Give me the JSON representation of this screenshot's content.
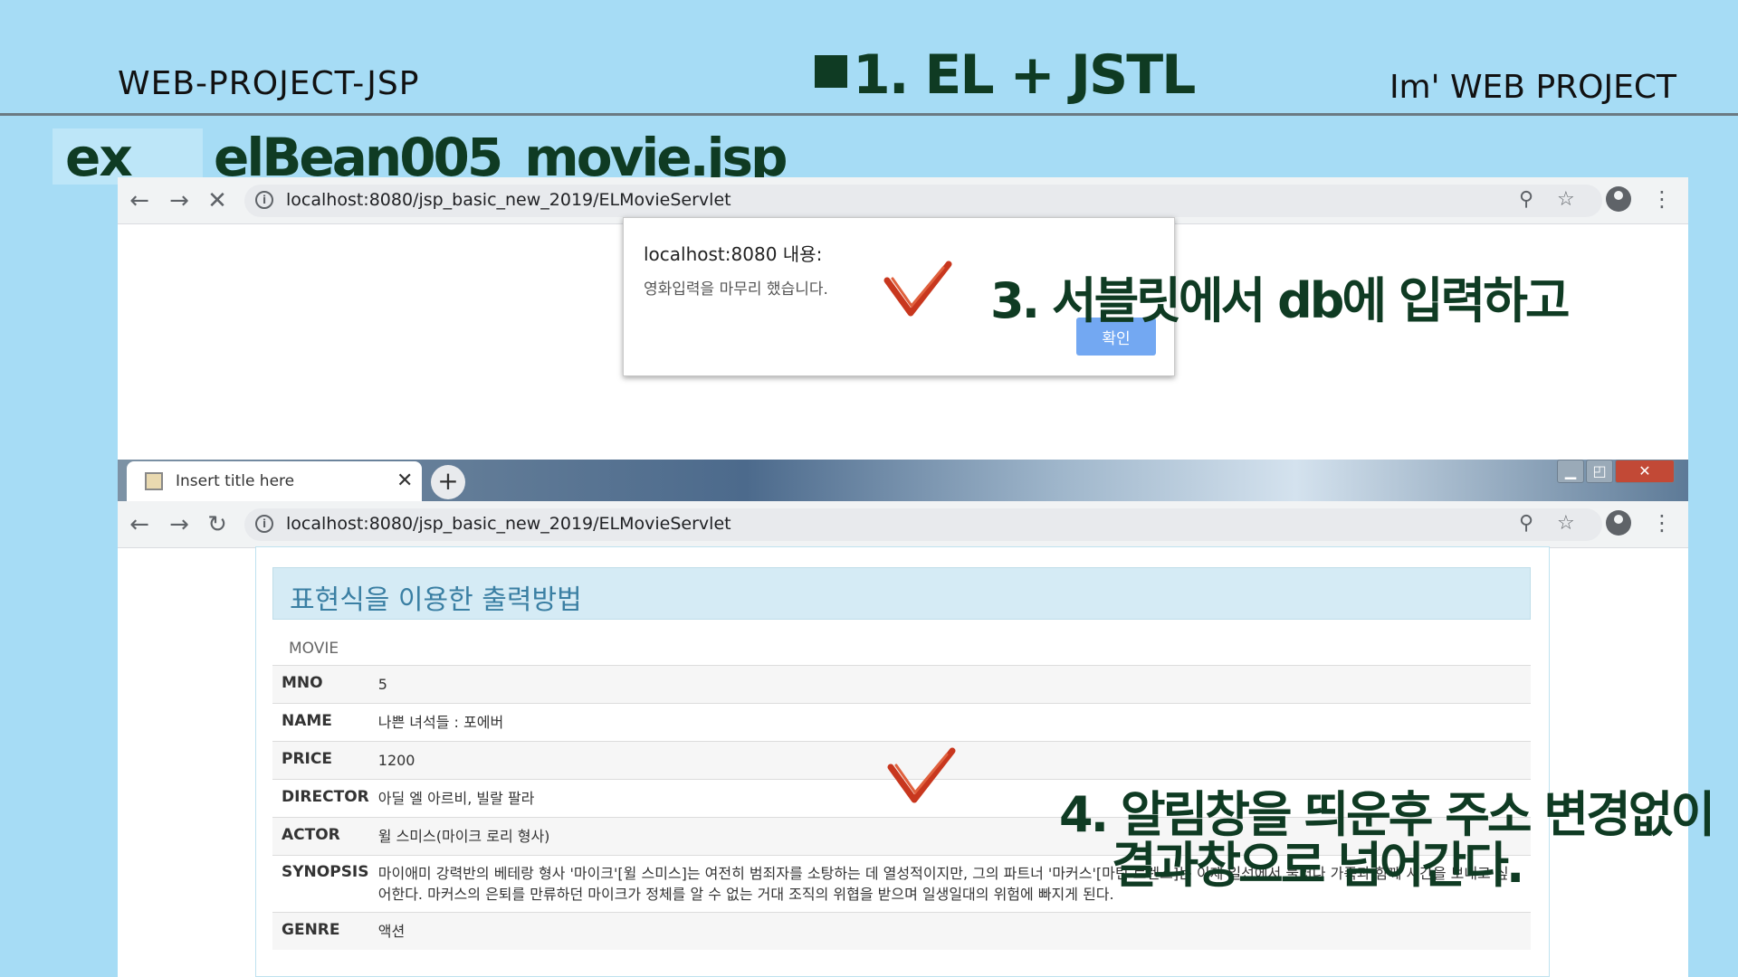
{
  "slide": {
    "left_title": "WEB-PROJECT-JSP",
    "center_title": "1. EL + JSTL",
    "right_title": "Im'  WEB PROJECT",
    "ex_label": "ex",
    "file_title": "elBean005_movie.jsp"
  },
  "browser_top": {
    "url": "localhost:8080/jsp_basic_new_2019/ELMovieServlet"
  },
  "alert": {
    "title": "localhost:8080 내용:",
    "message": "영화입력을 마무리 했습니다.",
    "ok_label": "확인"
  },
  "annotations": {
    "step3": "3. 서블릿에서   db에 입력하고",
    "step4_line1": "4. 알림창을 띄운후 주소 변경없이",
    "step4_line2": "결과창으로 넘어간다."
  },
  "browser_bottom": {
    "tab_title": "Insert title here",
    "url": "localhost:8080/jsp_basic_new_2019/ELMovieServlet"
  },
  "page": {
    "heading": "표현식을 이용한 출력방법",
    "section_label": "MOVIE",
    "rows": [
      {
        "label": "MNO",
        "value": "5"
      },
      {
        "label": "NAME",
        "value": "나쁜 녀석들 : 포에버"
      },
      {
        "label": "PRICE",
        "value": "1200"
      },
      {
        "label": "DIRECTOR",
        "value": "아딜 엘 아르비, 빌랄 팔라"
      },
      {
        "label": "ACTOR",
        "value": "윌 스미스(마이크 로리 형사)"
      },
      {
        "label": "SYNOPSIS",
        "value": "마이애미 강력반의 베테랑 형사 '마이크'[윌 스미스]는 여전히 범죄자를 소탕하는 데 열성적이지만, 그의 파트너 '마커스'[마틴 로렌스]는 이제 일선에서 물러나 가족과 함께 시간을 보내고 싶어한다. 마커스의 은퇴를 만류하던 마이크가 정체를 알 수 없는 거대 조직의 위협을 받으며 일생일대의 위험에 빠지게 된다."
      },
      {
        "label": "GENRE",
        "value": "액션"
      }
    ]
  },
  "colors": {
    "slide_bg": "#a6dcf5",
    "title_green": "#0f3b23",
    "check_red": "#c8371e",
    "ok_button": "#73a8f2"
  }
}
